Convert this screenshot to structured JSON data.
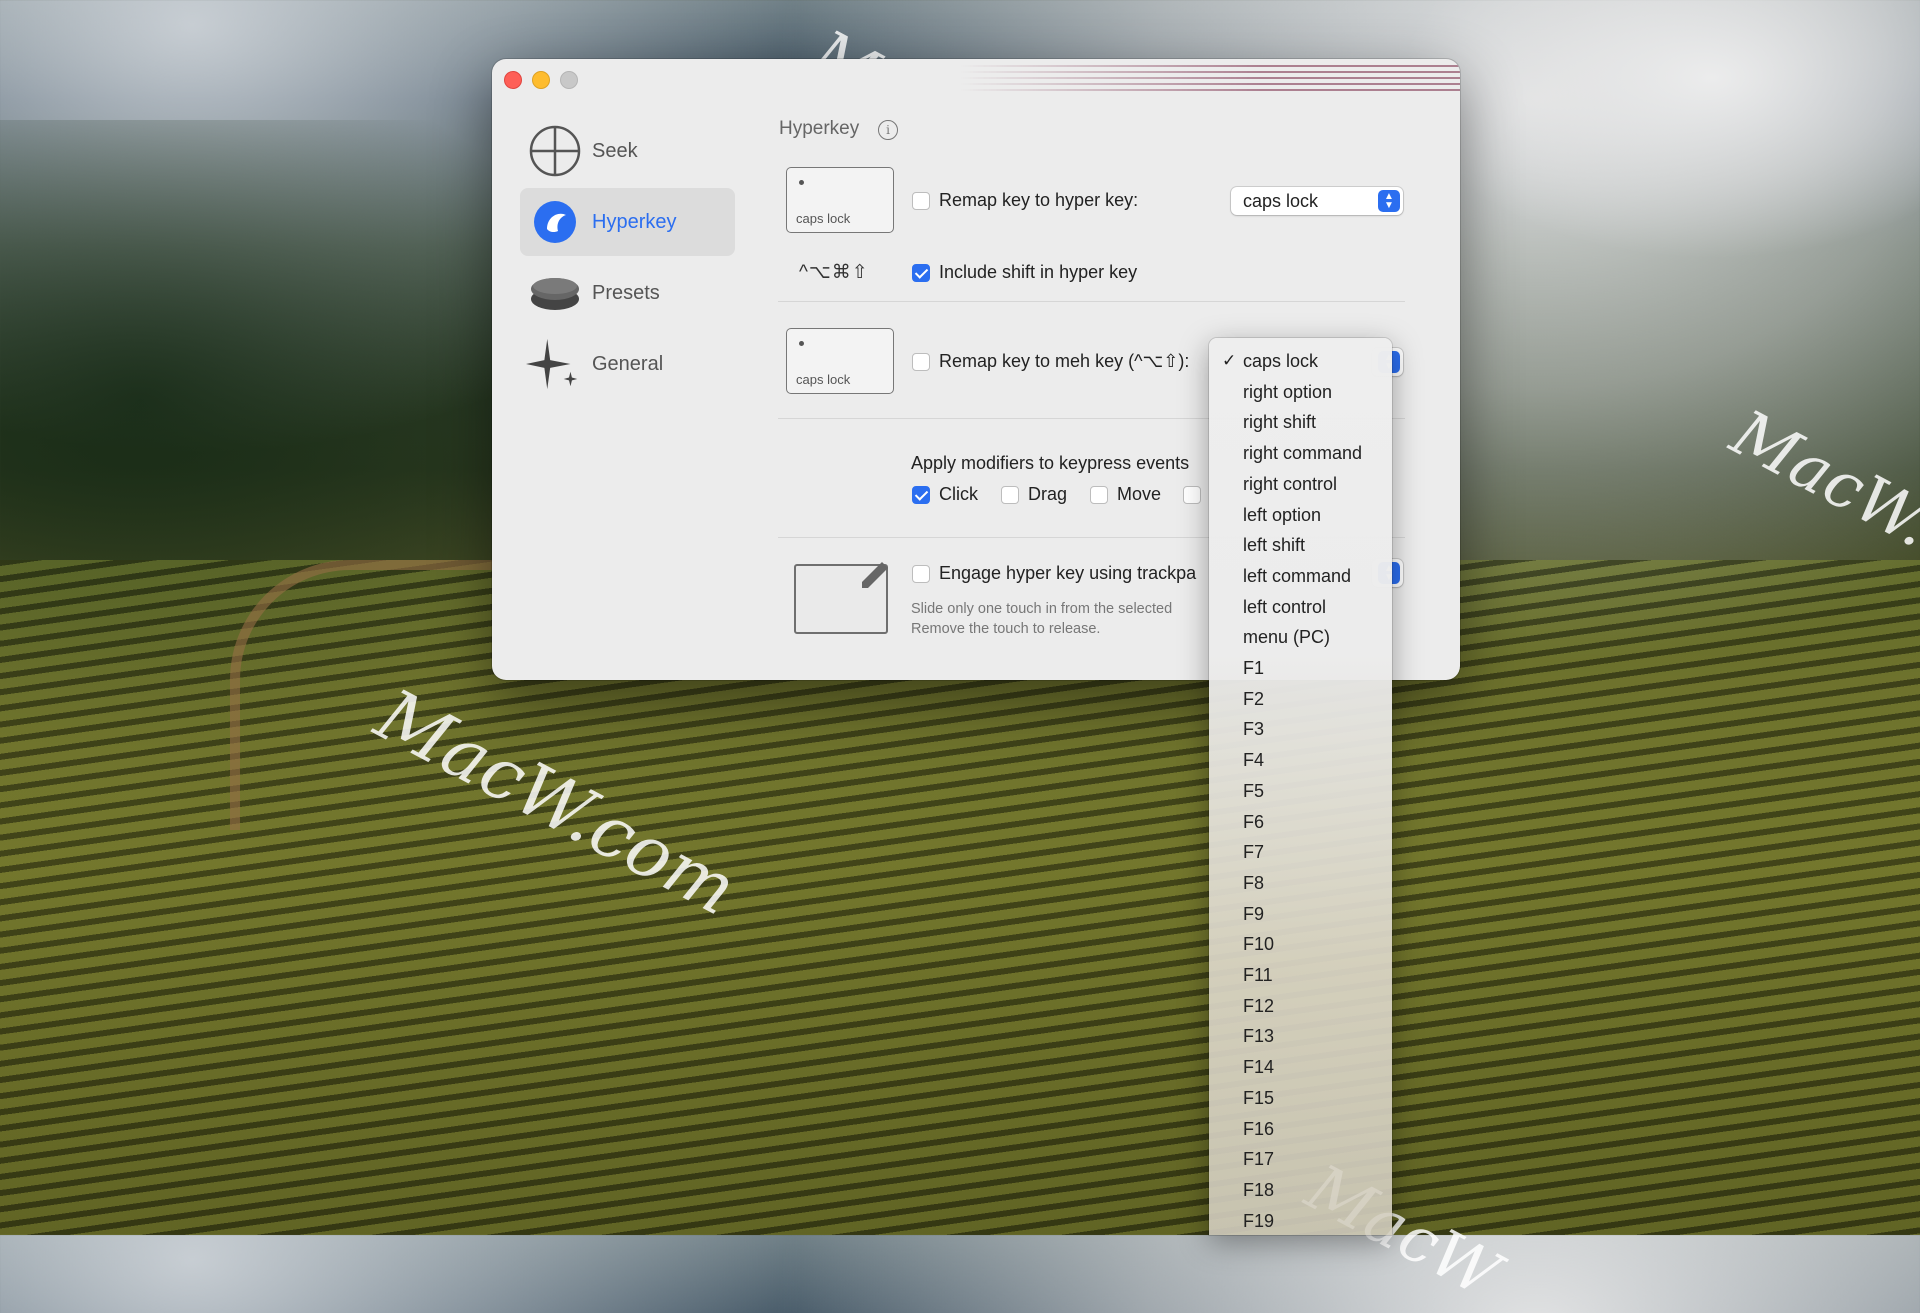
{
  "window": {
    "sidebar": {
      "items": [
        {
          "label": "Seek",
          "icon": "crosshair-icon",
          "selected": false
        },
        {
          "label": "Hyperkey",
          "icon": "hyperkey-icon",
          "selected": true
        },
        {
          "label": "Presets",
          "icon": "presets-icon",
          "selected": false
        },
        {
          "label": "General",
          "icon": "sparkle-icon",
          "selected": false
        }
      ]
    },
    "section_title": "Hyperkey",
    "info_glyph": "i",
    "hyper": {
      "keycap_label": "caps lock",
      "checkbox_label": "Remap key to hyper key:",
      "checked": false,
      "select_value": "caps lock"
    },
    "shift": {
      "symbols": "^⌥⌘⇧",
      "checkbox_label": "Include shift in hyper key",
      "checked": true
    },
    "meh": {
      "keycap_label": "caps lock",
      "checkbox_label": "Remap key to meh key (^⌥⇧):",
      "checked": false
    },
    "modifiers": {
      "title": "Apply modifiers to keypress events",
      "options": [
        {
          "label": "Click",
          "checked": true
        },
        {
          "label": "Drag",
          "checked": false
        },
        {
          "label": "Move",
          "checked": false
        },
        {
          "label": "",
          "checked": false
        }
      ]
    },
    "trackpad": {
      "checkbox_label": "Engage hyper key using trackpa",
      "checked": false,
      "help_line1": "Slide only one touch in from the selected",
      "help_line2": "Remove the touch to release."
    }
  },
  "dropdown": {
    "selected": "caps lock",
    "options": [
      "caps lock",
      "right option",
      "right shift",
      "right command",
      "right control",
      "left option",
      "left shift",
      "left command",
      "left control",
      "menu (PC)",
      "F1",
      "F2",
      "F3",
      "F4",
      "F5",
      "F6",
      "F7",
      "F8",
      "F9",
      "F10",
      "F11",
      "F12",
      "F13",
      "F14",
      "F15",
      "F16",
      "F17",
      "F18",
      "F19"
    ]
  },
  "watermarks": [
    "MacW.com",
    "MacW.com",
    "MacW.co",
    "MacW"
  ],
  "colors": {
    "accent": "#2b6ef0",
    "close": "#fe5f57",
    "minimize": "#febc2e"
  }
}
